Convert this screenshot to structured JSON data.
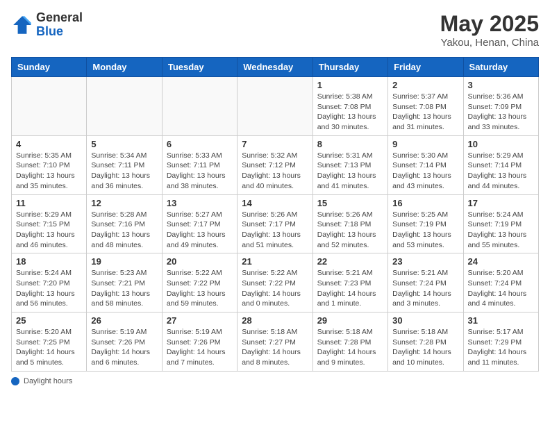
{
  "header": {
    "logo_general": "General",
    "logo_blue": "Blue",
    "title": "May 2025",
    "subtitle": "Yakou, Henan, China"
  },
  "days_of_week": [
    "Sunday",
    "Monday",
    "Tuesday",
    "Wednesday",
    "Thursday",
    "Friday",
    "Saturday"
  ],
  "weeks": [
    [
      {
        "day": "",
        "info": ""
      },
      {
        "day": "",
        "info": ""
      },
      {
        "day": "",
        "info": ""
      },
      {
        "day": "",
        "info": ""
      },
      {
        "day": "1",
        "info": "Sunrise: 5:38 AM\nSunset: 7:08 PM\nDaylight: 13 hours\nand 30 minutes."
      },
      {
        "day": "2",
        "info": "Sunrise: 5:37 AM\nSunset: 7:08 PM\nDaylight: 13 hours\nand 31 minutes."
      },
      {
        "day": "3",
        "info": "Sunrise: 5:36 AM\nSunset: 7:09 PM\nDaylight: 13 hours\nand 33 minutes."
      }
    ],
    [
      {
        "day": "4",
        "info": "Sunrise: 5:35 AM\nSunset: 7:10 PM\nDaylight: 13 hours\nand 35 minutes."
      },
      {
        "day": "5",
        "info": "Sunrise: 5:34 AM\nSunset: 7:11 PM\nDaylight: 13 hours\nand 36 minutes."
      },
      {
        "day": "6",
        "info": "Sunrise: 5:33 AM\nSunset: 7:11 PM\nDaylight: 13 hours\nand 38 minutes."
      },
      {
        "day": "7",
        "info": "Sunrise: 5:32 AM\nSunset: 7:12 PM\nDaylight: 13 hours\nand 40 minutes."
      },
      {
        "day": "8",
        "info": "Sunrise: 5:31 AM\nSunset: 7:13 PM\nDaylight: 13 hours\nand 41 minutes."
      },
      {
        "day": "9",
        "info": "Sunrise: 5:30 AM\nSunset: 7:14 PM\nDaylight: 13 hours\nand 43 minutes."
      },
      {
        "day": "10",
        "info": "Sunrise: 5:29 AM\nSunset: 7:14 PM\nDaylight: 13 hours\nand 44 minutes."
      }
    ],
    [
      {
        "day": "11",
        "info": "Sunrise: 5:29 AM\nSunset: 7:15 PM\nDaylight: 13 hours\nand 46 minutes."
      },
      {
        "day": "12",
        "info": "Sunrise: 5:28 AM\nSunset: 7:16 PM\nDaylight: 13 hours\nand 48 minutes."
      },
      {
        "day": "13",
        "info": "Sunrise: 5:27 AM\nSunset: 7:17 PM\nDaylight: 13 hours\nand 49 minutes."
      },
      {
        "day": "14",
        "info": "Sunrise: 5:26 AM\nSunset: 7:17 PM\nDaylight: 13 hours\nand 51 minutes."
      },
      {
        "day": "15",
        "info": "Sunrise: 5:26 AM\nSunset: 7:18 PM\nDaylight: 13 hours\nand 52 minutes."
      },
      {
        "day": "16",
        "info": "Sunrise: 5:25 AM\nSunset: 7:19 PM\nDaylight: 13 hours\nand 53 minutes."
      },
      {
        "day": "17",
        "info": "Sunrise: 5:24 AM\nSunset: 7:19 PM\nDaylight: 13 hours\nand 55 minutes."
      }
    ],
    [
      {
        "day": "18",
        "info": "Sunrise: 5:24 AM\nSunset: 7:20 PM\nDaylight: 13 hours\nand 56 minutes."
      },
      {
        "day": "19",
        "info": "Sunrise: 5:23 AM\nSunset: 7:21 PM\nDaylight: 13 hours\nand 58 minutes."
      },
      {
        "day": "20",
        "info": "Sunrise: 5:22 AM\nSunset: 7:22 PM\nDaylight: 13 hours\nand 59 minutes."
      },
      {
        "day": "21",
        "info": "Sunrise: 5:22 AM\nSunset: 7:22 PM\nDaylight: 14 hours\nand 0 minutes."
      },
      {
        "day": "22",
        "info": "Sunrise: 5:21 AM\nSunset: 7:23 PM\nDaylight: 14 hours\nand 1 minute."
      },
      {
        "day": "23",
        "info": "Sunrise: 5:21 AM\nSunset: 7:24 PM\nDaylight: 14 hours\nand 3 minutes."
      },
      {
        "day": "24",
        "info": "Sunrise: 5:20 AM\nSunset: 7:24 PM\nDaylight: 14 hours\nand 4 minutes."
      }
    ],
    [
      {
        "day": "25",
        "info": "Sunrise: 5:20 AM\nSunset: 7:25 PM\nDaylight: 14 hours\nand 5 minutes."
      },
      {
        "day": "26",
        "info": "Sunrise: 5:19 AM\nSunset: 7:26 PM\nDaylight: 14 hours\nand 6 minutes."
      },
      {
        "day": "27",
        "info": "Sunrise: 5:19 AM\nSunset: 7:26 PM\nDaylight: 14 hours\nand 7 minutes."
      },
      {
        "day": "28",
        "info": "Sunrise: 5:18 AM\nSunset: 7:27 PM\nDaylight: 14 hours\nand 8 minutes."
      },
      {
        "day": "29",
        "info": "Sunrise: 5:18 AM\nSunset: 7:28 PM\nDaylight: 14 hours\nand 9 minutes."
      },
      {
        "day": "30",
        "info": "Sunrise: 5:18 AM\nSunset: 7:28 PM\nDaylight: 14 hours\nand 10 minutes."
      },
      {
        "day": "31",
        "info": "Sunrise: 5:17 AM\nSunset: 7:29 PM\nDaylight: 14 hours\nand 11 minutes."
      }
    ]
  ],
  "footer": {
    "label": "Daylight hours"
  }
}
